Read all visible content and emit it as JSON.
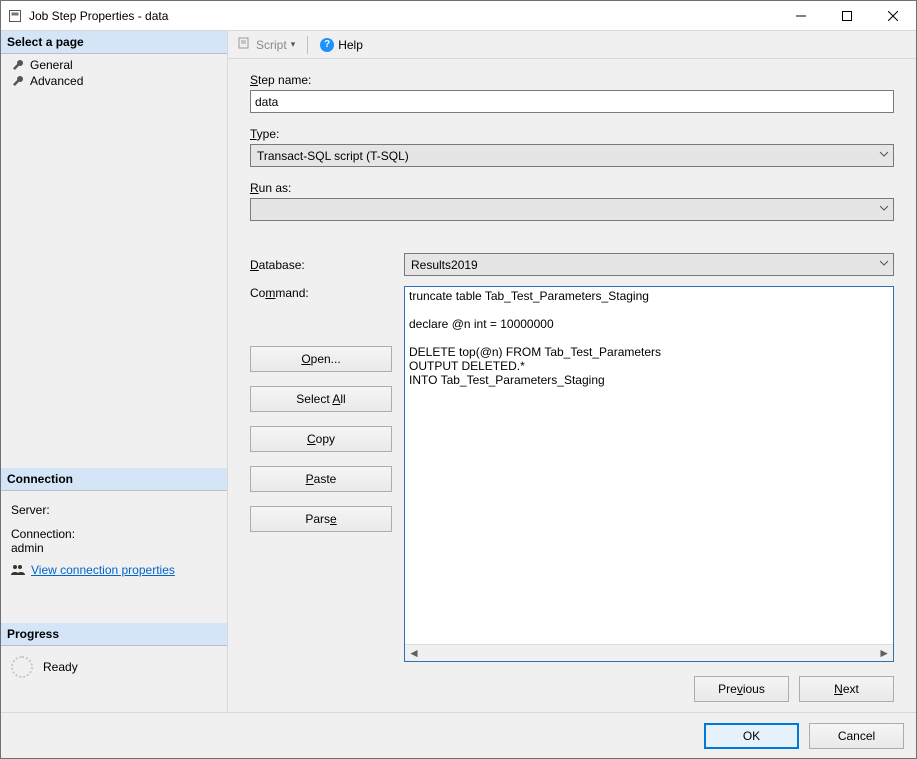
{
  "window": {
    "title": "Job Step Properties - data"
  },
  "sidebar": {
    "select_page_header": "Select a page",
    "pages": [
      {
        "label": "General"
      },
      {
        "label": "Advanced"
      }
    ],
    "connection_header": "Connection",
    "server_label": "Server:",
    "server_value": "",
    "connection_label": "Connection:",
    "connection_value": "admin",
    "view_connection_link": "View connection properties",
    "progress_header": "Progress",
    "progress_status": "Ready"
  },
  "toolbar": {
    "script_label": "Script",
    "help_label": "Help"
  },
  "form": {
    "step_name_label": "Step name:",
    "step_name_value": "data",
    "type_label": "Type:",
    "type_value": "Transact-SQL script (T-SQL)",
    "run_as_label": "Run as:",
    "run_as_value": "",
    "database_label": "Database:",
    "database_value": "Results2019",
    "command_label": "Command:",
    "command_value": "truncate table Tab_Test_Parameters_Staging\n\ndeclare @n int = 10000000\n\nDELETE top(@n) FROM Tab_Test_Parameters\nOUTPUT DELETED.*\nINTO Tab_Test_Parameters_Staging",
    "buttons": {
      "open": "Open...",
      "select_all": "Select All",
      "copy": "Copy",
      "paste": "Paste",
      "parse": "Parse"
    },
    "nav": {
      "previous": "Previous",
      "next": "Next"
    }
  },
  "footer": {
    "ok": "OK",
    "cancel": "Cancel"
  }
}
